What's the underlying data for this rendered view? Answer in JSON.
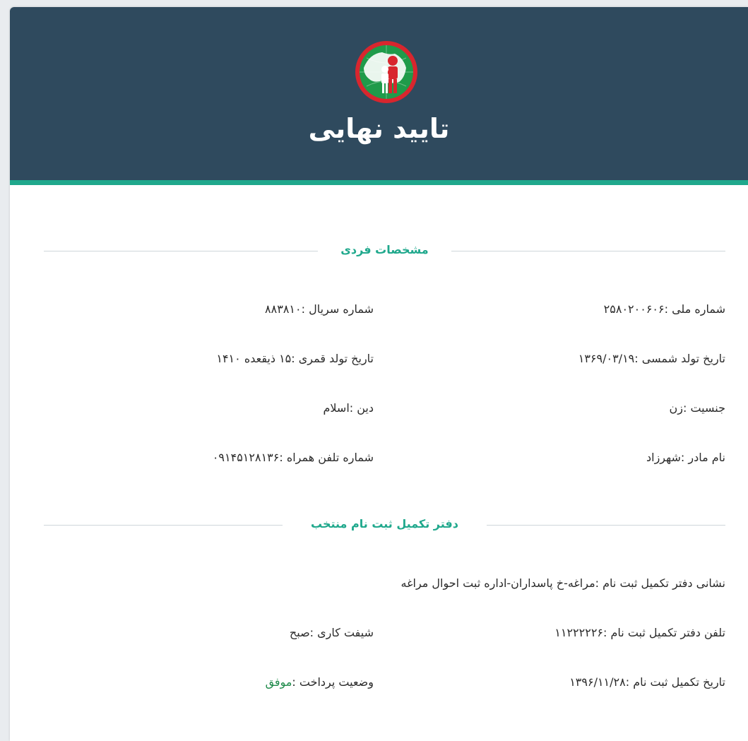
{
  "header": {
    "title": "تایید نهایی",
    "logo_icon": "iran-map-person-logo-icon",
    "bg_color": "#2f4a5e",
    "accent_color": "#1fa88c"
  },
  "personal": {
    "section_title": "مشخصات فردی",
    "fields": [
      {
        "key": "شماره ملی :",
        "value": "۲۵۸۰۲۰۰۶۰۶"
      },
      {
        "key": "شماره سریال :",
        "value": "۸۸۳۸۱۰"
      },
      {
        "key": "تاریخ تولد شمسی :",
        "value": "۱۳۶۹/۰۳/۱۹"
      },
      {
        "key": "تاریخ تولد قمری :",
        "value": "۱۵ ذیقعده ۱۴۱۰"
      },
      {
        "key": "جنسیت :",
        "value": "زن"
      },
      {
        "key": "دین :",
        "value": "اسلام"
      },
      {
        "key": "نام مادر :",
        "value": "شهرزاد"
      },
      {
        "key": "شماره تلفن همراه :",
        "value": "۰۹۱۴۵۱۲۸۱۳۶"
      }
    ]
  },
  "office": {
    "section_title": "دفتر تکمیل ثبت نام منتخب",
    "address": {
      "key": "نشانی دفتر تکمیل ثبت نام :",
      "value": "مراغه-خ پاسداران-اداره ثبت احوال مراغه"
    },
    "fields": [
      {
        "key": "تلفن دفتر تکمیل ثبت نام :",
        "value": "۱۱۲۲۲۲۲۶"
      },
      {
        "key": "شیفت کاری :",
        "value": "صبح"
      },
      {
        "key": "تاریخ تکمیل ثبت نام :",
        "value": "۱۳۹۶/۱۱/۲۸"
      },
      {
        "key": "وضعیت پرداخت :",
        "value": "موفق"
      }
    ]
  }
}
